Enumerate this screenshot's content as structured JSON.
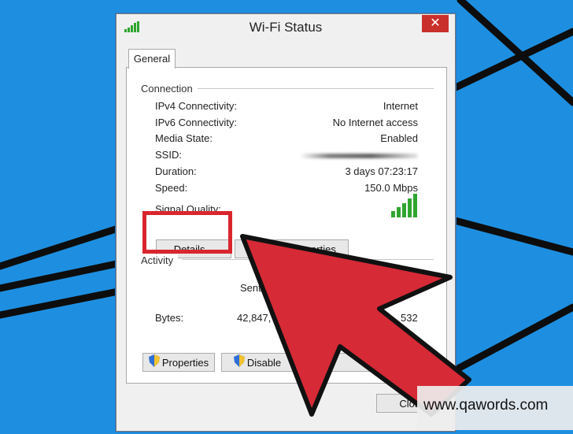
{
  "window": {
    "title": "Wi-Fi Status",
    "close_label": "✕"
  },
  "tabs": [
    {
      "label": "General"
    }
  ],
  "connection": {
    "section_label": "Connection",
    "rows": [
      {
        "label": "IPv4 Connectivity:",
        "value": "Internet"
      },
      {
        "label": "IPv6 Connectivity:",
        "value": "No Internet access"
      },
      {
        "label": "Media State:",
        "value": "Enabled"
      },
      {
        "label": "SSID:",
        "value": ""
      },
      {
        "label": "Duration:",
        "value": "3 days 07:23:17"
      },
      {
        "label": "Speed:",
        "value": "150.0 Mbps"
      },
      {
        "label": "Signal Quality:",
        "value": ""
      }
    ],
    "signal_bars": 5
  },
  "buttons": {
    "details": "Details...",
    "wireless_properties": "Wireless Properties",
    "properties": "Properties",
    "disable": "Disable",
    "close": "Close"
  },
  "activity": {
    "section_label": "Activity",
    "sent_label": "Sent",
    "bytes_label": "Bytes:",
    "bytes_sent": "42,847,767",
    "bytes_received_partial": "532"
  },
  "watermark": {
    "text": "www.qawords.com"
  },
  "colors": {
    "desktop": "#1e8fe0",
    "highlight": "#d9262e",
    "arrow": "#d62a36",
    "signal_green": "#2fa52f",
    "close_button": "#c9302c"
  }
}
